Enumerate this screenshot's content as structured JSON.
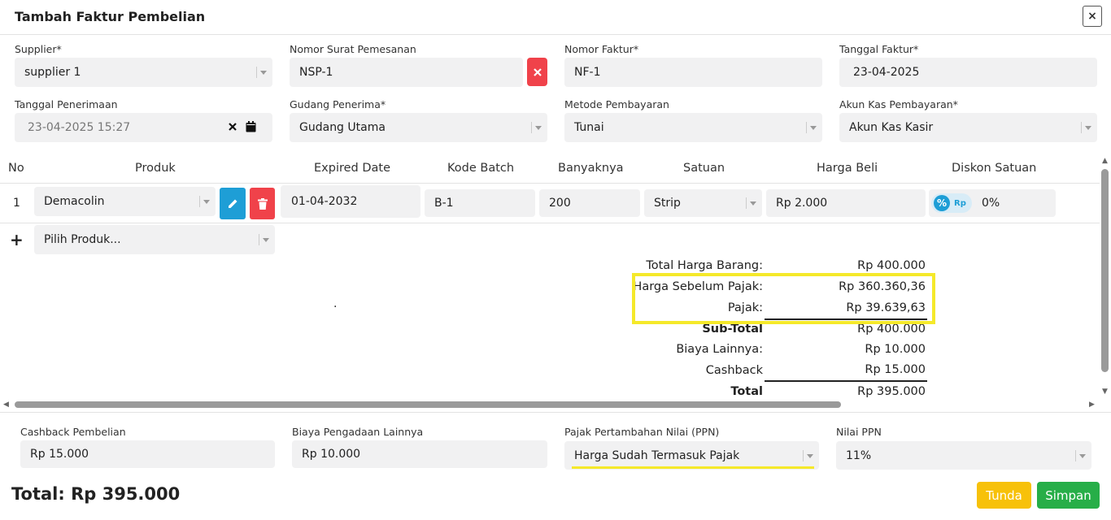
{
  "header": {
    "title": "Tambah Faktur Pembelian",
    "close_label": "×"
  },
  "form": {
    "supplier": {
      "label": "Supplier*",
      "value": "supplier 1"
    },
    "nomor_surat": {
      "label": "Nomor Surat Pemesanan",
      "value": "NSP-1"
    },
    "nomor_faktur": {
      "label": "Nomor Faktur*",
      "value": "NF-1"
    },
    "tanggal_faktur": {
      "label": "Tanggal Faktur*",
      "value": "23-04-2025"
    },
    "tanggal_penerimaan": {
      "label": "Tanggal Penerimaan",
      "value": "23-04-2025 15:27"
    },
    "gudang": {
      "label": "Gudang Penerima*",
      "value": "Gudang Utama"
    },
    "metode": {
      "label": "Metode Pembayaran",
      "value": "Tunai"
    },
    "akun_kas": {
      "label": "Akun Kas Pembayaran*",
      "value": "Akun Kas Kasir"
    }
  },
  "table": {
    "headers": [
      "No",
      "Produk",
      "Expired Date",
      "Kode Batch",
      "Banyaknya",
      "Satuan",
      "Harga Beli",
      "Diskon Satuan"
    ],
    "rows": [
      {
        "no": "1",
        "produk": "Demacolin",
        "expired": "01-04-2032",
        "batch": "B-1",
        "qty": "200",
        "satuan": "Strip",
        "harga": "Rp 2.000",
        "diskon": "0%"
      }
    ],
    "add_placeholder": "Pilih Produk...",
    "add_icon": "+",
    "discount_rp": "Rp",
    "discount_pct": "%",
    "dot": "."
  },
  "summary": {
    "total_harga_label": "Total Harga Barang:",
    "total_harga_value": "Rp 400.000",
    "sebelum_pajak_label": "Harga Sebelum Pajak:",
    "sebelum_pajak_value": "Rp 360.360,36",
    "pajak_label": "Pajak:",
    "pajak_value": "Rp 39.639,63",
    "subtotal_label": "Sub-Total",
    "subtotal_value": "Rp 400.000",
    "biaya_label": "Biaya Lainnya:",
    "biaya_value": "Rp 10.000",
    "cashback_label": "Cashback",
    "cashback_value": "Rp 15.000",
    "total_label": "Total",
    "total_value": "Rp 395.000"
  },
  "footer_form": {
    "cashback": {
      "label": "Cashback Pembelian",
      "value": "Rp 15.000"
    },
    "biaya": {
      "label": "Biaya Pengadaan Lainnya",
      "value": "Rp 10.000"
    },
    "ppn": {
      "label": "Pajak Pertambahan Nilai (PPN)",
      "value": "Harga Sudah Termasuk Pajak"
    },
    "nilai_ppn": {
      "label": "Nilai PPN",
      "value": "11%"
    }
  },
  "footer": {
    "total_text": "Total: Rp 395.000",
    "tunda_label": "Tunda",
    "simpan_label": "Simpan"
  },
  "colors": {
    "highlight": "#f5e92a",
    "danger": "#f0424a",
    "info": "#1e9ed6",
    "warning": "#f7c10a",
    "success": "#27ae48"
  }
}
